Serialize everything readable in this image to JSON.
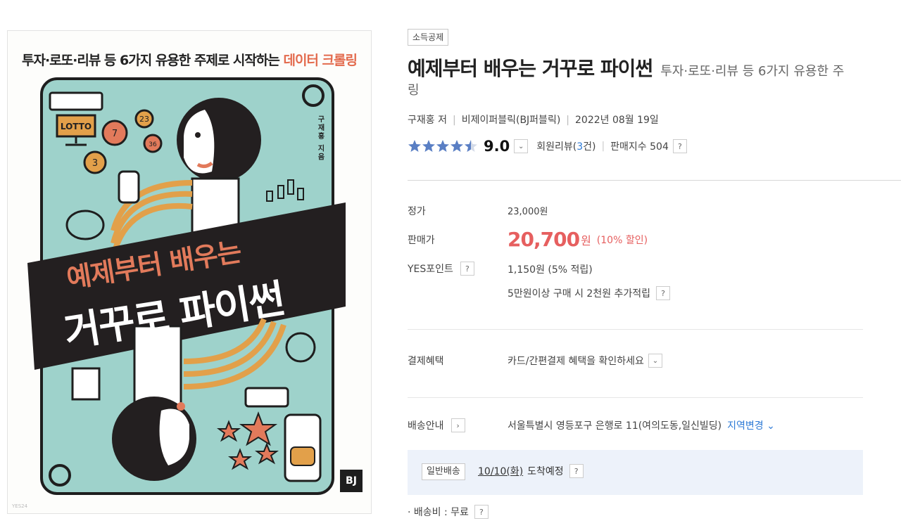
{
  "cover": {
    "subtitle_prefix": "투자·로또·리뷰 등 6가지 유용한 주제로 시작하는",
    "subtitle_highlight": "데이터 크롤링",
    "title_line1": "예제부터 배우는",
    "title_line2": "거꾸로 파이썬",
    "author_vertical": "구재홍 지음",
    "lotto_label": "LOTTO",
    "ball_numbers": [
      "7",
      "23",
      "36",
      "3"
    ],
    "publisher_logo": "BJ",
    "watermark": "YES24"
  },
  "product": {
    "tag": "소득공제",
    "title": "예제부터 배우는 거꾸로 파이썬",
    "subtitle": "투자·로또·리뷰 등 6가지 유용한 주",
    "subtitle_wrap": "링",
    "author": "구재홍 저",
    "publisher": "비제이퍼블릭(BJ퍼블릭)",
    "date": "2022년 08월 19일",
    "rating": 9.0,
    "rating_text": "9.0",
    "review_prefix": "회원리뷰(",
    "review_count": "3",
    "review_suffix": "건)",
    "sales_index": "판매지수 504",
    "help_mark": "?",
    "dropdown_mark": "⌄"
  },
  "pricing": {
    "list_label": "정가",
    "list_price": "23,000원",
    "sale_label": "판매가",
    "sale_price": "20,700",
    "sale_unit": "원",
    "discount": "(10% 할인)",
    "points_label": "YES포인트",
    "points_value": "1,150원 (5% 적립)",
    "points_extra": "5만원이상 구매 시 2천원 추가적립"
  },
  "payment": {
    "label": "결제혜택",
    "value": "카드/간편결제 혜택을 확인하세요"
  },
  "delivery": {
    "label": "배송안내",
    "address": "서울특별시 영등포구 은행로 11(여의도동,일신빌딩)",
    "change_region": "지역변경",
    "shipping_type": "일반배송",
    "arrival_date": "10/10(화)",
    "arrival_suffix": "도착예정",
    "fee": "· 배송비 : 무료"
  },
  "colors": {
    "price_red": "#e65f5f",
    "link_blue": "#2d7ad6",
    "cover_mint": "#9ed2cb",
    "cover_orange": "#e2a04a",
    "cover_banner": "#231f20",
    "star_blue": "#5a7fc4"
  }
}
